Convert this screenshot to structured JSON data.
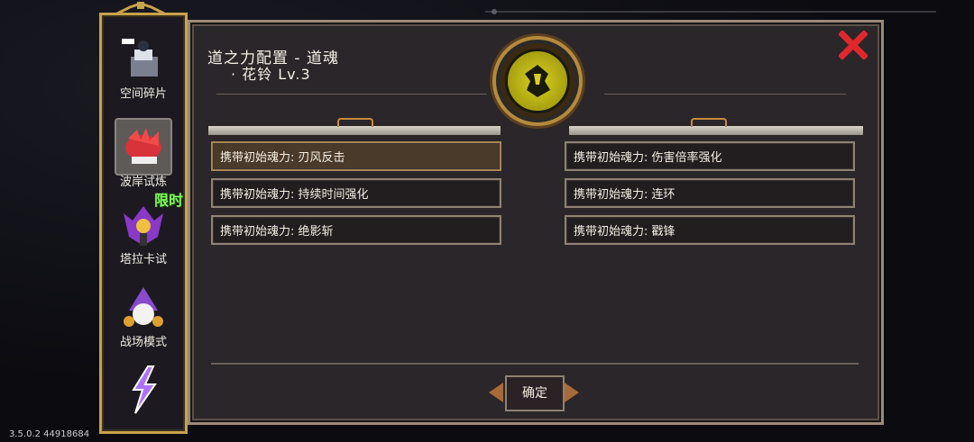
{
  "sidebar": {
    "items": [
      {
        "label": "空间碎片",
        "icon": "space-fragment-icon"
      },
      {
        "label": "波岸试炼",
        "icon": "shore-trial-icon",
        "active": true
      },
      {
        "label": "塔拉卡试",
        "icon": "tarak-trial-icon",
        "badge": "限时"
      },
      {
        "label": "战场模式",
        "icon": "battlefield-icon"
      },
      {
        "label": "",
        "icon": "lightning-icon"
      }
    ]
  },
  "dialog": {
    "title": "道之力配置 - 道魂",
    "subtitle": "· 花铃 Lv.3",
    "left_options": [
      {
        "text": "携带初始魂力: 刃风反击",
        "selected": true
      },
      {
        "text": "携带初始魂力: 持续时间强化"
      },
      {
        "text": "携带初始魂力: 绝影斩"
      }
    ],
    "right_options": [
      {
        "text": "携带初始魂力: 伤害倍率强化"
      },
      {
        "text": "携带初始魂力: 连环"
      },
      {
        "text": "携带初始魂力: 戳锋"
      }
    ],
    "confirm_label": "确定"
  },
  "footer": {
    "version": "3.5.0.2 44918684"
  },
  "colors": {
    "accent_gold": "#c9a24a",
    "close_red": "#e0282c",
    "panel_bg": "#2b2629"
  }
}
